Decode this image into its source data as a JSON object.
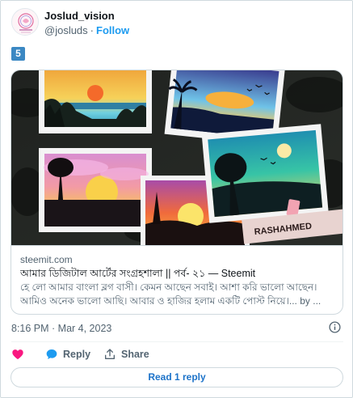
{
  "author": {
    "name": "Joslud_vision",
    "handle": "@josluds",
    "separator": "·",
    "follow_label": "Follow",
    "avatar_logo_text": "Joslud_vision"
  },
  "tweet_badge": "5",
  "card": {
    "domain": "steemit.com",
    "title": "আমার ডিজিটাল আর্টের সংগ্রহশালা || পর্ব- ২১ — Steemit",
    "description": "হে লো আমার বাংলা ব্লগ বাসী। কেমন আছেন সবাই। আশা করি ভালো আছেন। আমিও অনেক ভালো আছি। আবার ও হাজির হলাম একটি পোস্ট নিয়ে।... by ...",
    "image_watermark": "RASHAHMED"
  },
  "meta": {
    "timestamp": "8:16 PM · Mar 4, 2023"
  },
  "actions": {
    "like_icon": "heart-icon",
    "reply_label": "Reply",
    "share_label": "Share"
  },
  "read_replies_label": "Read 1 reply",
  "colors": {
    "accent": "#1d9bf0",
    "like": "#f91880",
    "text_secondary": "#536471",
    "border": "#cfd9de"
  }
}
